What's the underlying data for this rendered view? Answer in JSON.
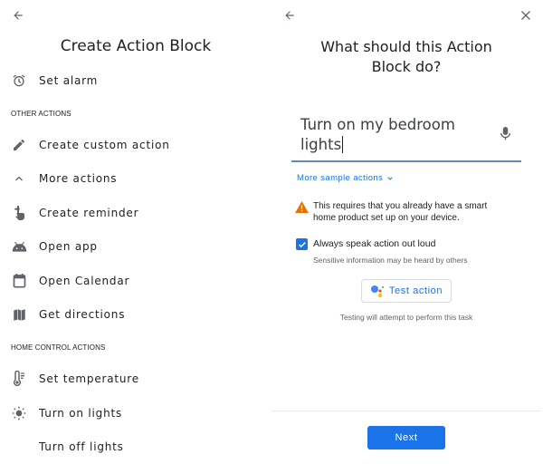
{
  "left": {
    "title": "Create Action Block",
    "items_top": [
      {
        "label": "Set alarm",
        "icon": "alarm-icon"
      }
    ],
    "other_header": "OTHER ACTIONS",
    "other_items": [
      {
        "label": "Create custom action",
        "icon": "pencil-icon"
      },
      {
        "label": "More actions",
        "icon": "chevron-up-icon"
      },
      {
        "label": "Create reminder",
        "icon": "reminder-hand-icon"
      },
      {
        "label": "Open app",
        "icon": "android-icon"
      },
      {
        "label": "Open Calendar",
        "icon": "calendar-icon"
      },
      {
        "label": "Get directions",
        "icon": "map-icon"
      }
    ],
    "home_header": "HOME CONTROL ACTIONS",
    "home_items": [
      {
        "label": "Set temperature",
        "icon": "thermometer-icon"
      },
      {
        "label": "Turn on lights",
        "icon": "sun-icon"
      },
      {
        "label": "Turn off lights",
        "icon": "moon-icon"
      }
    ]
  },
  "right": {
    "title_line1": "What should this Action",
    "title_line2": "Block do?",
    "input_line1": "Turn on my bedroom",
    "input_line2": "lights",
    "more_samples": "More sample actions",
    "warning_line1": "This requires that you already have a smart",
    "warning_line2": "home product set up on your device.",
    "checkbox_label": "Always speak action out loud",
    "checkbox_checked": true,
    "checkbox_sub": "Sensitive information may be heard by others",
    "test_button": "Test action",
    "test_note": "Testing will attempt to perform this task",
    "next_button": "Next"
  },
  "colors": {
    "accent": "#1a73e8",
    "warning": "#e37400",
    "underline": "#5b8bc0"
  }
}
